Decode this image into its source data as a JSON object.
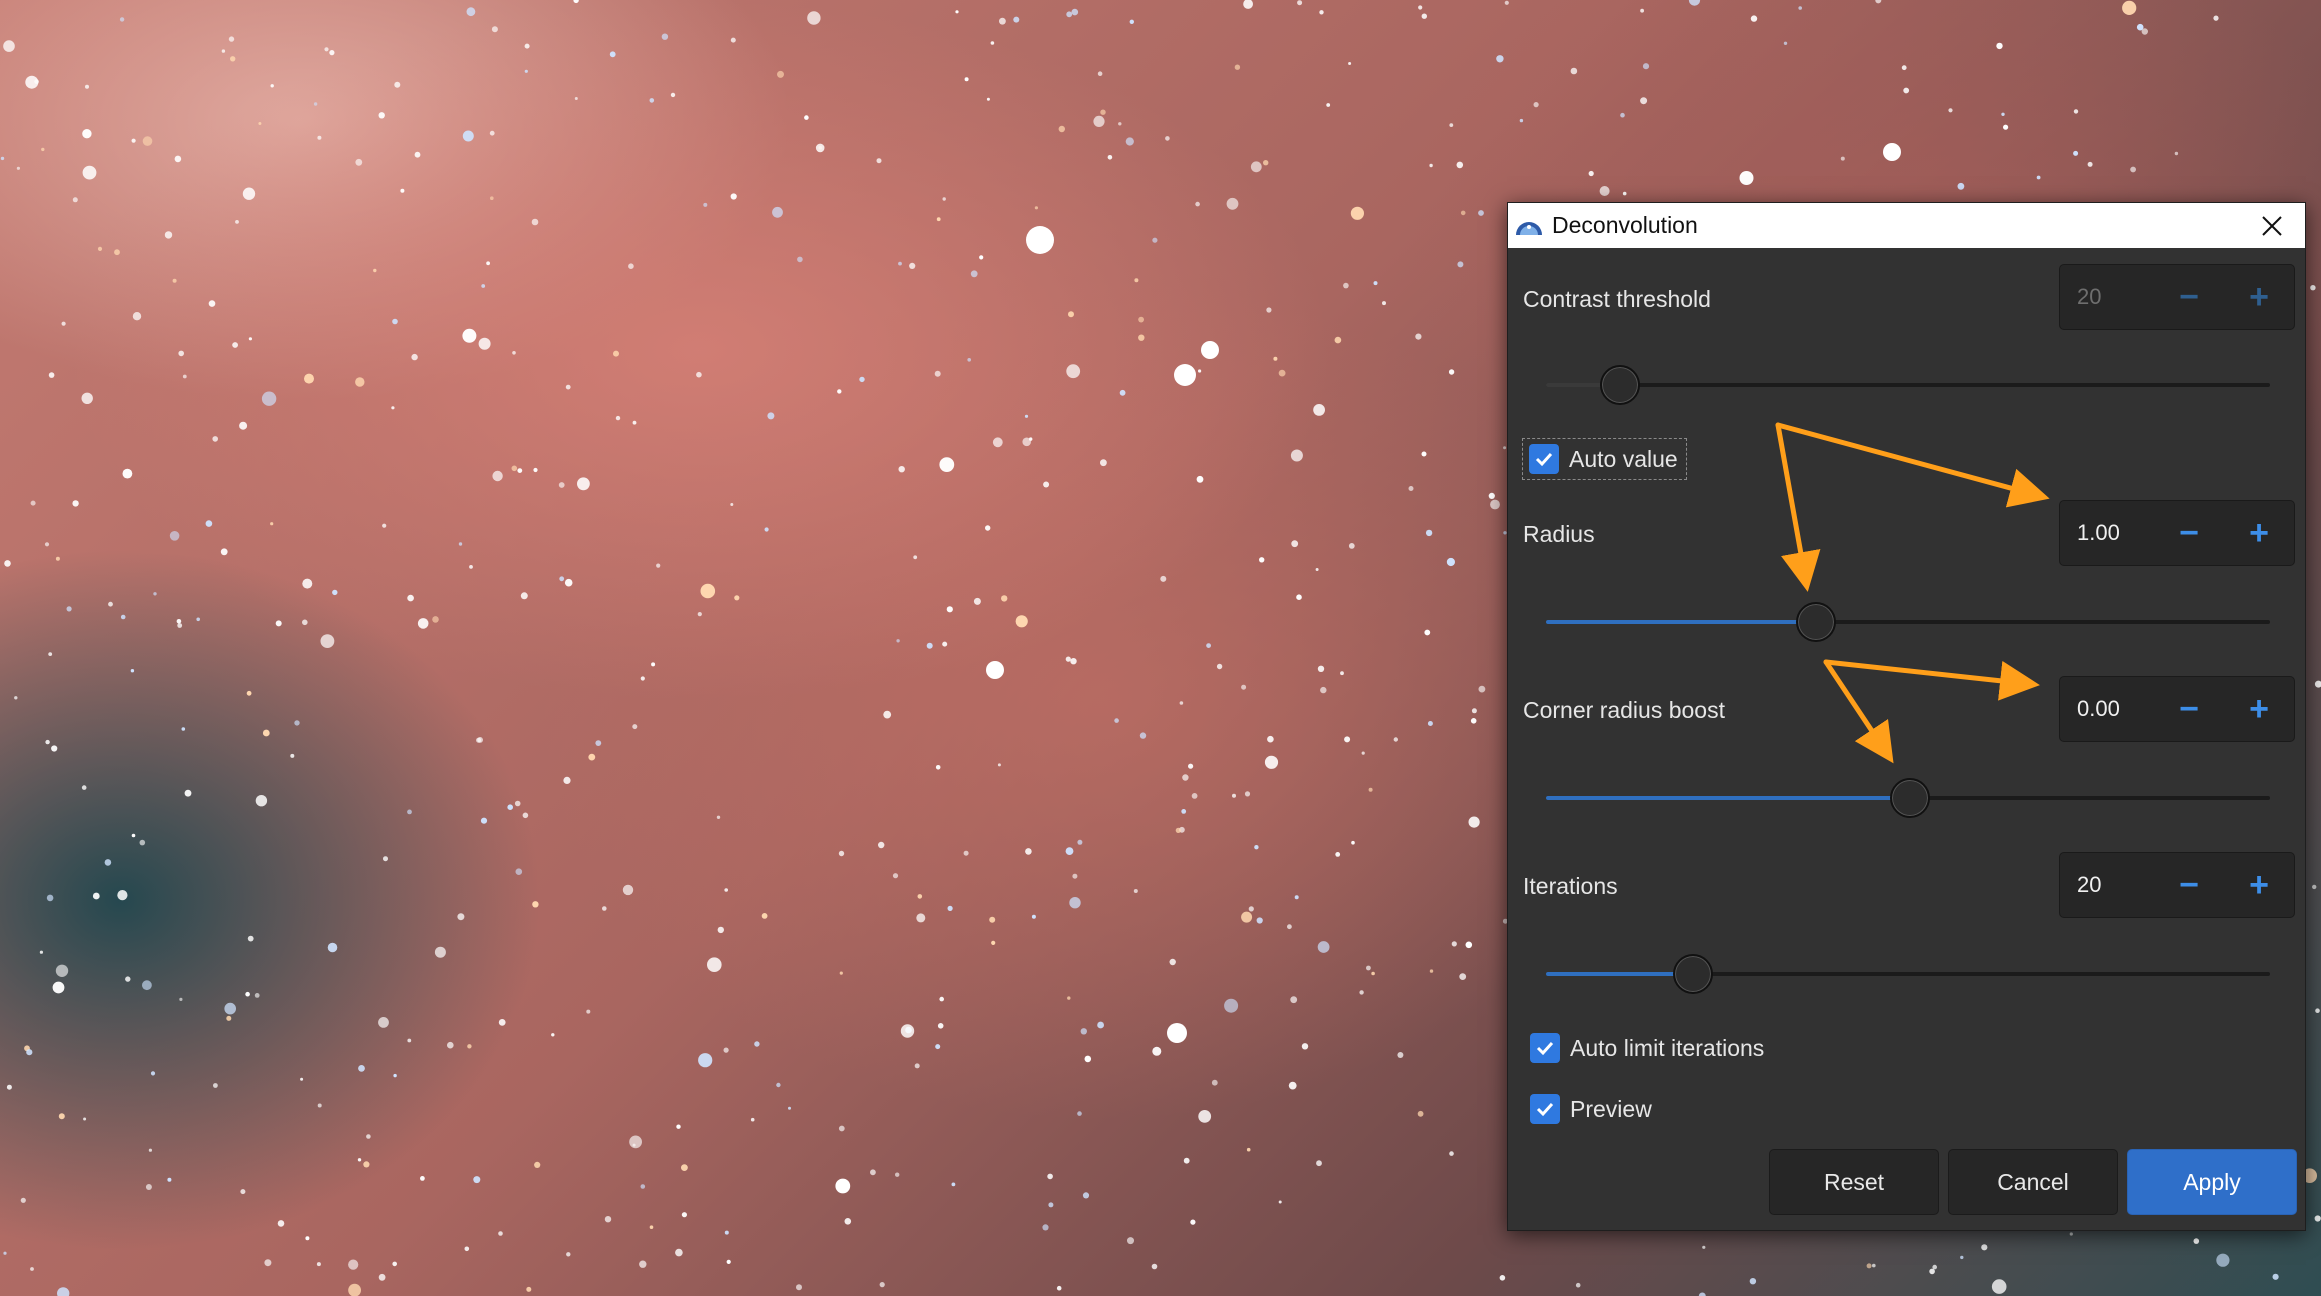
{
  "dialog": {
    "title": "Deconvolution",
    "contrast_threshold": {
      "label": "Contrast threshold",
      "value": "20",
      "slider_fraction": 0.1
    },
    "auto_value": {
      "label": "Auto value",
      "checked": true
    },
    "radius": {
      "label": "Radius",
      "value": "1.00",
      "slider_fraction": 0.37
    },
    "corner_radius_boost": {
      "label": "Corner radius boost",
      "value": "0.00",
      "slider_fraction": 0.5
    },
    "iterations": {
      "label": "Iterations",
      "value": "20",
      "slider_fraction": 0.2
    },
    "auto_limit_iterations": {
      "label": "Auto limit iterations",
      "checked": true
    },
    "preview": {
      "label": "Preview",
      "checked": true
    },
    "buttons": {
      "reset": "Reset",
      "cancel": "Cancel",
      "apply": "Apply"
    }
  },
  "colors": {
    "accent": "#2f79e0",
    "apply_button": "#2f6fc9",
    "annotation_arrows": "#ff9f1a",
    "dialog_bg": "#323232"
  },
  "icons": {
    "spin_decrement": "minus-icon",
    "spin_increment": "plus-icon",
    "close": "close-icon",
    "app": "app-logo-icon",
    "check": "checkmark-icon"
  }
}
